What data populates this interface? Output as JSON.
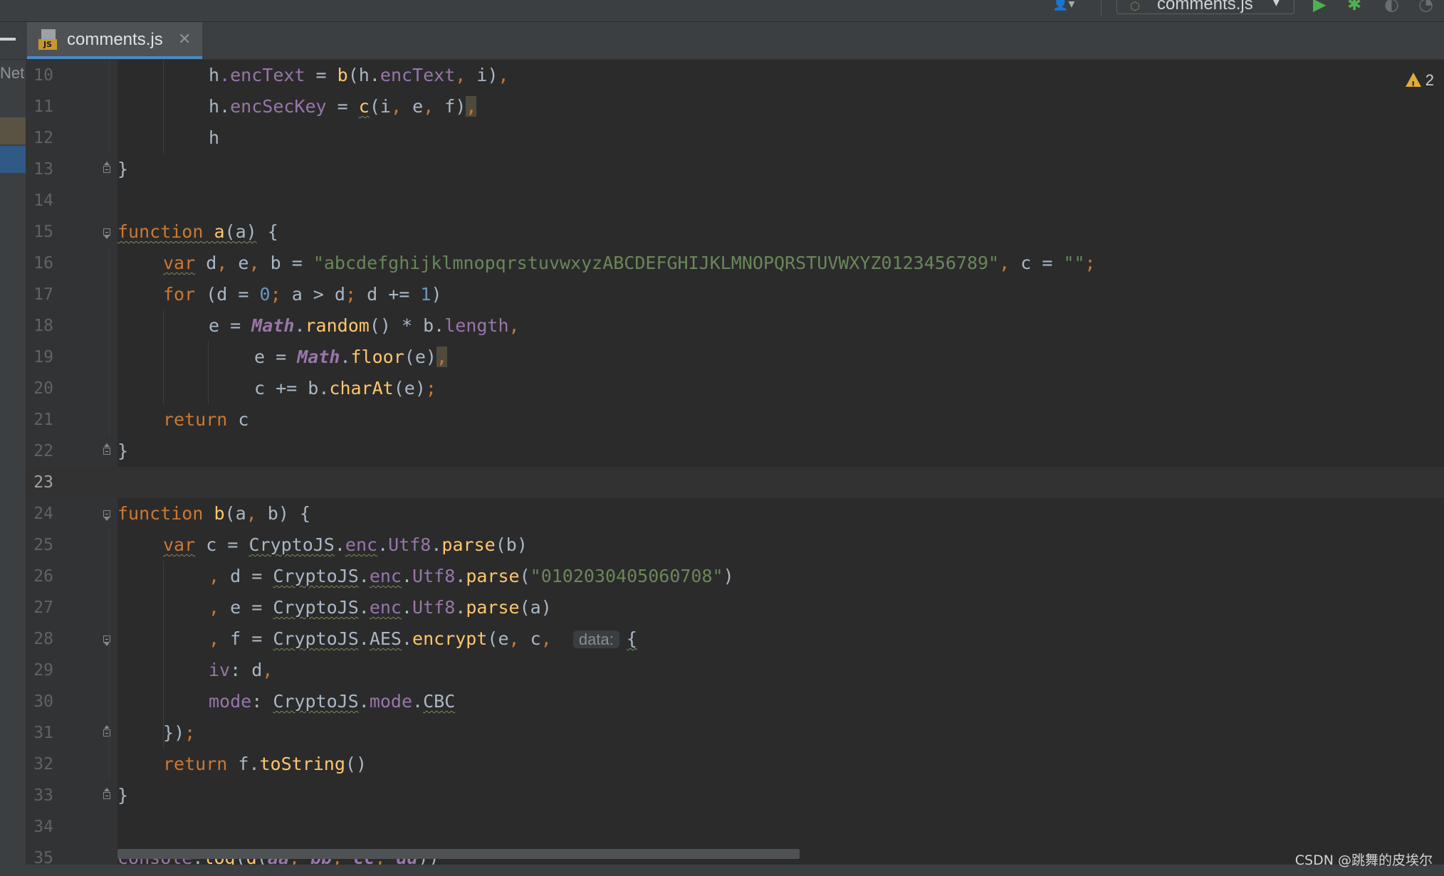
{
  "toolbar": {
    "run_config_name": "comments.js"
  },
  "editor_tab": {
    "file_name": "comments.js",
    "file_type_badge": "JS",
    "close_glyph": "✕"
  },
  "left_panel": {
    "partial_label": "Net"
  },
  "inspections": {
    "warning_count": "2",
    "warning_icon": "warning-triangle-icon",
    "warning_color": "#e2a93c"
  },
  "editor": {
    "current_line": 23,
    "lines": [
      {
        "n": "10",
        "text": "        h.encText = b(h.encText, i),"
      },
      {
        "n": "11",
        "text": "        h.encSecKey = c(i, e, f),"
      },
      {
        "n": "12",
        "text": "        h"
      },
      {
        "n": "13",
        "text": "}"
      },
      {
        "n": "14",
        "text": ""
      },
      {
        "n": "15",
        "text": "function a(a) {"
      },
      {
        "n": "16",
        "text": "    var d, e, b = \"abcdefghijklmnopqrstuvwxyzABCDEFGHIJKLMNOPQRSTUVWXYZ0123456789\", c = \"\";"
      },
      {
        "n": "17",
        "text": "    for (d = 0; a > d; d += 1)"
      },
      {
        "n": "18",
        "text": "        e = Math.random() * b.length,"
      },
      {
        "n": "19",
        "text": "            e = Math.floor(e),"
      },
      {
        "n": "20",
        "text": "            c += b.charAt(e);"
      },
      {
        "n": "21",
        "text": "    return c"
      },
      {
        "n": "22",
        "text": "}"
      },
      {
        "n": "23",
        "text": ""
      },
      {
        "n": "24",
        "text": "function b(a, b) {"
      },
      {
        "n": "25",
        "text": "    var c = CryptoJS.enc.Utf8.parse(b)"
      },
      {
        "n": "26",
        "text": "        , d = CryptoJS.enc.Utf8.parse(\"0102030405060708\")"
      },
      {
        "n": "27",
        "text": "        , e = CryptoJS.enc.Utf8.parse(a)"
      },
      {
        "n": "28",
        "text": "        , f = CryptoJS.AES.encrypt(e, c,  data: {"
      },
      {
        "n": "29",
        "text": "        iv: d,"
      },
      {
        "n": "30",
        "text": "        mode: CryptoJS.mode.CBC"
      },
      {
        "n": "31",
        "text": "    });"
      },
      {
        "n": "32",
        "text": "    return f.toString()"
      },
      {
        "n": "33",
        "text": "}"
      },
      {
        "n": "34",
        "text": ""
      },
      {
        "n": "35",
        "text": "console.log(d(aa, bb, cc, dd))"
      }
    ],
    "tokens": {
      "h": "h",
      "dot": ".",
      "encText": "encText",
      "encSecKey": "encSecKey",
      "eq": " = ",
      "b": "b",
      "c": "c",
      "i": "i",
      "e": "e",
      "f": "f",
      "d": "d",
      "a": "a",
      "lparen": "(",
      "rparen": ")",
      "comma": ",",
      "semi": ";",
      "lbrace": "{",
      "rbrace": "}",
      "sp": " ",
      "function": "function",
      "var": "var",
      "for": "for",
      "return": "return",
      "alphabet_string": "\"abcdefghijklmnopqrstuvwxyzABCDEFGHIJKLMNOPQRSTUVWXYZ0123456789\"",
      "empty_string": "\"\"",
      "zero": "0",
      "one": "1",
      "gt": " > ",
      "pluseq": " += ",
      "times": " * ",
      "Math": "Math",
      "random": "random",
      "floor": "floor",
      "length": "length",
      "charAt": "charAt",
      "CryptoJS": "CryptoJS",
      "enc": "enc",
      "Utf8": "Utf8",
      "parse": "parse",
      "iv_string": "\"0102030405060708\"",
      "AES": "AES",
      "encrypt": "encrypt",
      "data_hint": "data:",
      "iv": "iv",
      "colon": ": ",
      "mode": "mode",
      "CBC": "CBC",
      "toString": "toString",
      "console": "console",
      "log": "log",
      "aa": "aa",
      "bb": "bb",
      "cc": "cc",
      "dd": "dd"
    }
  },
  "watermark": "CSDN @跳舞的皮埃尔"
}
